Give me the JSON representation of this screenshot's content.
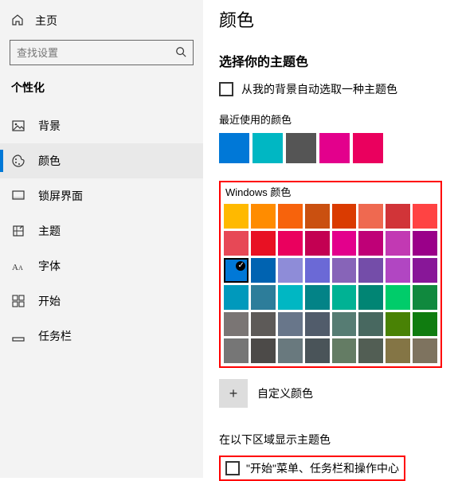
{
  "sidebar": {
    "home_label": "主页",
    "search_placeholder": "查找设置",
    "section_title": "个性化",
    "items": [
      {
        "label": "背景",
        "icon": "picture"
      },
      {
        "label": "颜色",
        "icon": "palette"
      },
      {
        "label": "锁屏界面",
        "icon": "lock-screen"
      },
      {
        "label": "主题",
        "icon": "theme"
      },
      {
        "label": "字体",
        "icon": "font"
      },
      {
        "label": "开始",
        "icon": "start"
      },
      {
        "label": "任务栏",
        "icon": "taskbar"
      }
    ],
    "active_index": 1
  },
  "main": {
    "page_title": "颜色",
    "choose_accent_heading": "选择你的主题色",
    "auto_pick_label": "从我的背景自动选取一种主题色",
    "recent_label": "最近使用的颜色",
    "recent_colors": [
      "#0078d7",
      "#00b7c3",
      "#555555",
      "#e3008c",
      "#ea005e"
    ],
    "windows_colors_label": "Windows 颜色",
    "grid_colors": [
      "#ffb900",
      "#ff8c00",
      "#f7630c",
      "#ca5010",
      "#da3b01",
      "#ef6950",
      "#d13438",
      "#ff4343",
      "#e74856",
      "#e81123",
      "#ea005e",
      "#c30052",
      "#e3008c",
      "#bf0077",
      "#c239b3",
      "#9a0089",
      "#0078d7",
      "#0063b1",
      "#8e8cd8",
      "#6b69d6",
      "#8764b8",
      "#744da9",
      "#b146c2",
      "#881798",
      "#0099bc",
      "#2d7d9a",
      "#00b7c3",
      "#038387",
      "#00b294",
      "#018574",
      "#00cc6a",
      "#10893e",
      "#7a7574",
      "#5d5a58",
      "#68768a",
      "#515c6b",
      "#567c73",
      "#486860",
      "#498205",
      "#107c10",
      "#767676",
      "#4c4a48",
      "#69797e",
      "#4a5459",
      "#647c64",
      "#525e54",
      "#847545",
      "#7e735f"
    ],
    "selected_index": 16,
    "custom_color_label": "自定义颜色",
    "show_accent_heading": "在以下区域显示主题色",
    "start_taskbar_label": "\"开始\"菜单、任务栏和操作中心"
  }
}
